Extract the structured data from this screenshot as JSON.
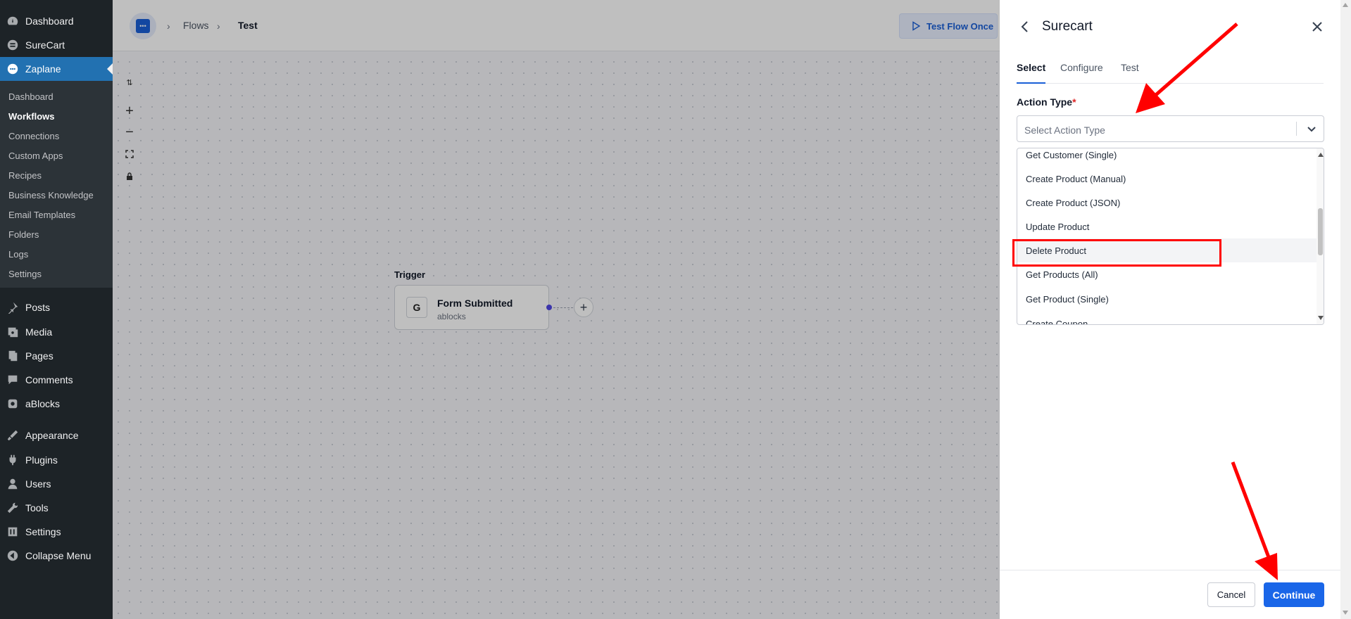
{
  "sidebar": {
    "top_items": [
      {
        "label": "Dashboard",
        "icon": "dashboard-icon"
      },
      {
        "label": "SureCart",
        "icon": "surecart-icon"
      },
      {
        "label": "Zaplane",
        "icon": "zaplane-icon"
      }
    ],
    "submenu": [
      "Dashboard",
      "Workflows",
      "Connections",
      "Custom Apps",
      "Recipes",
      "Business Knowledge",
      "Email Templates",
      "Folders",
      "Logs",
      "Settings"
    ],
    "bottom_items": [
      {
        "label": "Posts",
        "icon": "pin-icon"
      },
      {
        "label": "Media",
        "icon": "media-icon"
      },
      {
        "label": "Pages",
        "icon": "pages-icon"
      },
      {
        "label": "Comments",
        "icon": "comments-icon"
      },
      {
        "label": "aBlocks",
        "icon": "ablocks-icon"
      },
      {
        "label": "Appearance",
        "icon": "appearance-icon"
      },
      {
        "label": "Plugins",
        "icon": "plugins-icon"
      },
      {
        "label": "Users",
        "icon": "users-icon"
      },
      {
        "label": "Tools",
        "icon": "tools-icon"
      },
      {
        "label": "Settings",
        "icon": "settings-icon"
      },
      {
        "label": "Collapse Menu",
        "icon": "collapse-icon"
      }
    ]
  },
  "breadcrumb": {
    "flows": "Flows",
    "current": "Test"
  },
  "toolbar": {
    "test_flow": "Test Flow Once"
  },
  "canvas": {
    "trigger_label": "Trigger",
    "node_title": "Form Submitted",
    "node_subtitle": "ablocks",
    "node_icon_letter": "G"
  },
  "panel": {
    "title": "Surecart",
    "tabs": [
      "Select",
      "Configure",
      "Test"
    ],
    "field_label": "Action Type",
    "required_mark": "*",
    "placeholder": "Select Action Type",
    "options": [
      "Get Customer (Single)",
      "Create Product (Manual)",
      "Create Product (JSON)",
      "Update Product",
      "Delete Product",
      "Get Products (All)",
      "Get Product (Single)",
      "Create Coupon"
    ],
    "cancel": "Cancel",
    "continue": "Continue"
  },
  "colors": {
    "accent": "#1a66e8",
    "admin_bar": "#1d2327",
    "highlight": "#ff0000"
  }
}
